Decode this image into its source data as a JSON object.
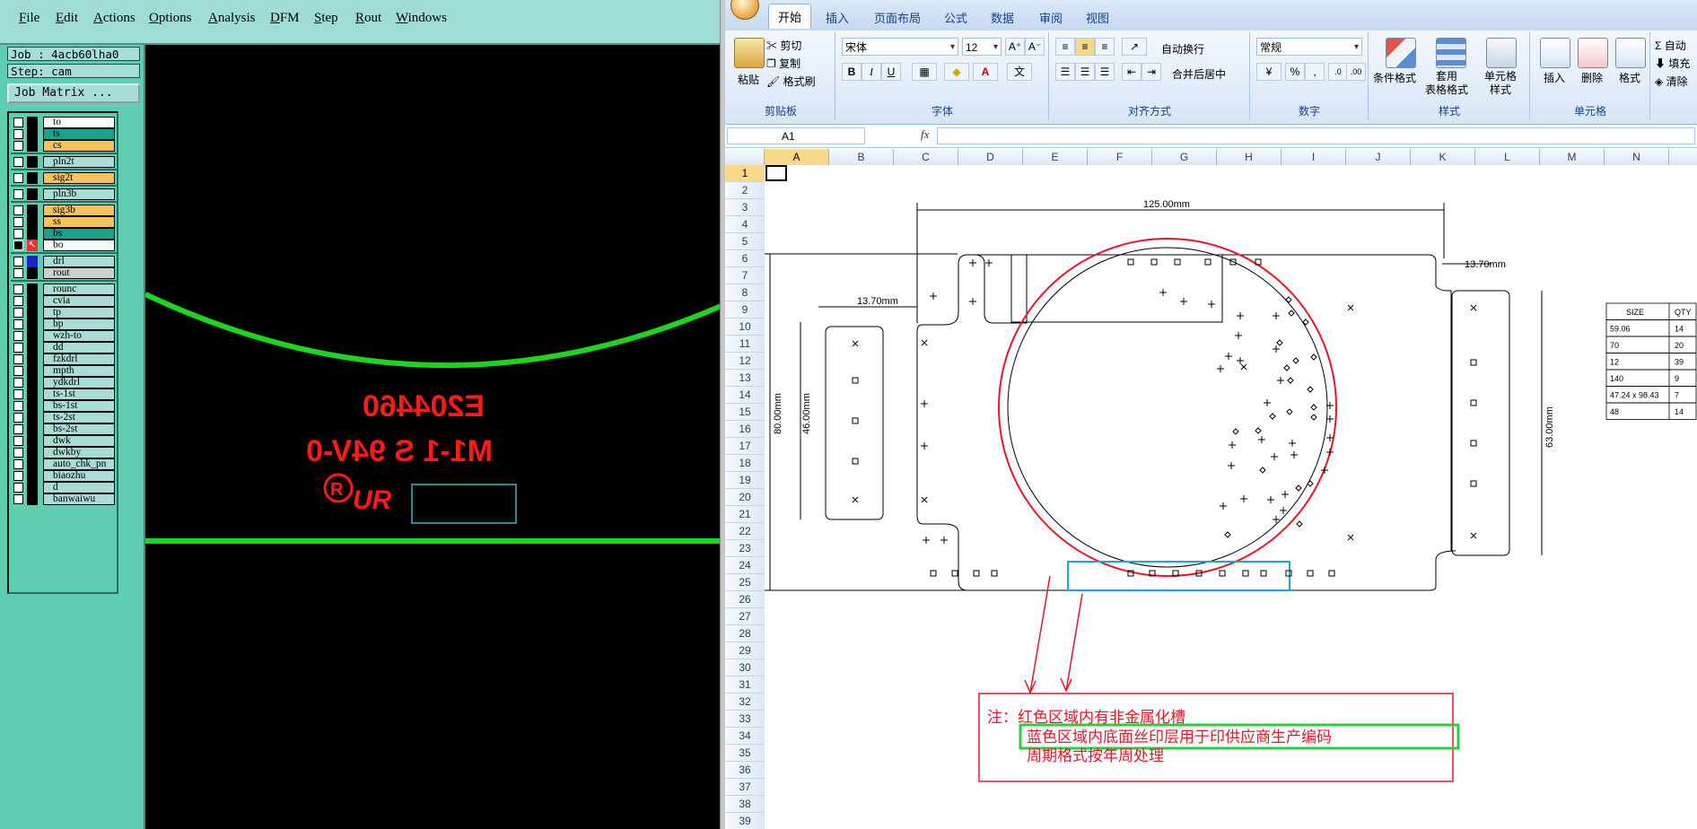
{
  "cam": {
    "menu": [
      "File",
      "Edit",
      "Actions",
      "Options",
      "Analysis",
      "DFM",
      "Step",
      "Rout",
      "Windows"
    ],
    "job_label": "Job : 4acb60lha0",
    "step_label": "Step: cam",
    "job_matrix_button": "Job Matrix ...",
    "layers": [
      {
        "name": "to",
        "bg": "#ffffff",
        "group": 0
      },
      {
        "name": "ts",
        "bg": "#1aa38a",
        "group": 0
      },
      {
        "name": "cs",
        "bg": "#f7c25a",
        "group": 0
      },
      {
        "name": "pln2t",
        "bg": "#a8ddd6",
        "group": 1
      },
      {
        "name": "sig2t",
        "bg": "#f7c25a",
        "group": 2
      },
      {
        "name": "pln3b",
        "bg": "#a8ddd6",
        "group": 3
      },
      {
        "name": "sig3b",
        "bg": "#f7c25a",
        "group": 4
      },
      {
        "name": "ss",
        "bg": "#f7c25a",
        "group": 4
      },
      {
        "name": "bs",
        "bg": "#1aa38a",
        "group": 4
      },
      {
        "name": "bo",
        "bg": "#ffffff",
        "group": 4,
        "active": true
      },
      {
        "name": "drl",
        "bg": "#a8ddd6",
        "group": 5,
        "mark": "#1f1fd0"
      },
      {
        "name": "rout",
        "bg": "#cfcfcf",
        "group": 5
      },
      {
        "name": "rounc",
        "bg": "#a8ddd6",
        "group": 6
      },
      {
        "name": "cvia",
        "bg": "#a8ddd6",
        "group": 6
      },
      {
        "name": "tp",
        "bg": "#a8ddd6",
        "group": 6
      },
      {
        "name": "bp",
        "bg": "#a8ddd6",
        "group": 6
      },
      {
        "name": "wzh-to",
        "bg": "#a8ddd6",
        "group": 6
      },
      {
        "name": "dd",
        "bg": "#a8ddd6",
        "group": 6
      },
      {
        "name": "fzkdrl",
        "bg": "#a8ddd6",
        "group": 6
      },
      {
        "name": "mpth",
        "bg": "#a8ddd6",
        "group": 6
      },
      {
        "name": "ydkdrl",
        "bg": "#a8ddd6",
        "group": 6
      },
      {
        "name": "ts-1st",
        "bg": "#a8ddd6",
        "group": 6
      },
      {
        "name": "bs-1st",
        "bg": "#a8ddd6",
        "group": 6
      },
      {
        "name": "ts-2st",
        "bg": "#a8ddd6",
        "group": 6
      },
      {
        "name": "bs-2st",
        "bg": "#a8ddd6",
        "group": 6
      },
      {
        "name": "dwk",
        "bg": "#a8ddd6",
        "group": 6
      },
      {
        "name": "dwkby",
        "bg": "#a8ddd6",
        "group": 6
      },
      {
        "name": "auto_chk_pn",
        "bg": "#a8ddd6",
        "group": 6
      },
      {
        "name": "biaozhu",
        "bg": "#a8ddd6",
        "group": 6
      },
      {
        "name": "d",
        "bg": "#a8ddd6",
        "group": 6
      },
      {
        "name": "banwaiwu",
        "bg": "#a8ddd6",
        "group": 6
      }
    ],
    "canvas_texts": {
      "line1": "E204460",
      "line2": "M1-1 S 94V-0",
      "logo_letter": "R",
      "logo_text": "UR"
    },
    "colors": {
      "green": "#1ed41e",
      "red": "#ff1a1a",
      "cyan": "#36b7c6"
    }
  },
  "excel": {
    "tabs": [
      "开始",
      "插入",
      "页面布局",
      "公式",
      "数据",
      "审阅",
      "视图"
    ],
    "active_tab": "开始",
    "clipboard": {
      "paste": "粘贴",
      "cut": "剪切",
      "copy": "复制",
      "painter": "格式刷",
      "label": "剪贴板"
    },
    "font": {
      "name": "宋体",
      "size": "12",
      "bold": "B",
      "italic": "I",
      "underline": "U",
      "label": "字体"
    },
    "alignment": {
      "wrap": "自动换行",
      "merge": "合并后居中",
      "label": "对齐方式"
    },
    "number": {
      "format": "常规",
      "percent": "%",
      "comma": ",",
      "label": "数字"
    },
    "styles": {
      "conditional": "条件格式",
      "table": "套用\n表格格式",
      "cell": "单元格\n样式",
      "label": "样式"
    },
    "cells": {
      "insert": "插入",
      "delete": "删除",
      "format": "格式",
      "label": "单元格"
    },
    "editing": {
      "autosum": "自动",
      "fill": "填充",
      "clear": "清除"
    },
    "name_box": "A1",
    "fx": "fx",
    "columns": [
      "A",
      "B",
      "C",
      "D",
      "E",
      "F",
      "G",
      "H",
      "I",
      "J",
      "K",
      "L",
      "M",
      "N",
      "O"
    ],
    "rows": [
      "1",
      "2",
      "3",
      "4",
      "5",
      "6",
      "7",
      "8",
      "9",
      "10",
      "11",
      "12",
      "13",
      "14",
      "15",
      "16",
      "17",
      "18",
      "19",
      "20",
      "21",
      "22",
      "23",
      "24",
      "25",
      "26",
      "27",
      "28",
      "29",
      "30",
      "31",
      "32",
      "33",
      "34",
      "35",
      "36",
      "37",
      "38",
      "39"
    ],
    "drawing": {
      "dim_width": "125.00mm",
      "dim_left": "13.70mm",
      "dim_right": "13.70mm",
      "dim_height": "80.00mm",
      "dim_inner": "46.00mm",
      "dim_right_h": "63.00mm"
    },
    "size_table": {
      "headers": [
        "SIZE",
        "QTY"
      ],
      "rows": [
        [
          "59.06",
          "14"
        ],
        [
          "70",
          "20"
        ],
        [
          "12",
          "39"
        ],
        [
          "140",
          "9"
        ],
        [
          "47.24 x 98.43",
          "7"
        ],
        [
          "48",
          "14"
        ]
      ]
    },
    "note": {
      "line1": "注：红色区域内有非金属化槽",
      "line2": "蓝色区域内底面丝印层用于印供应商生产编码",
      "line3": "周期格式按年周处理"
    }
  }
}
